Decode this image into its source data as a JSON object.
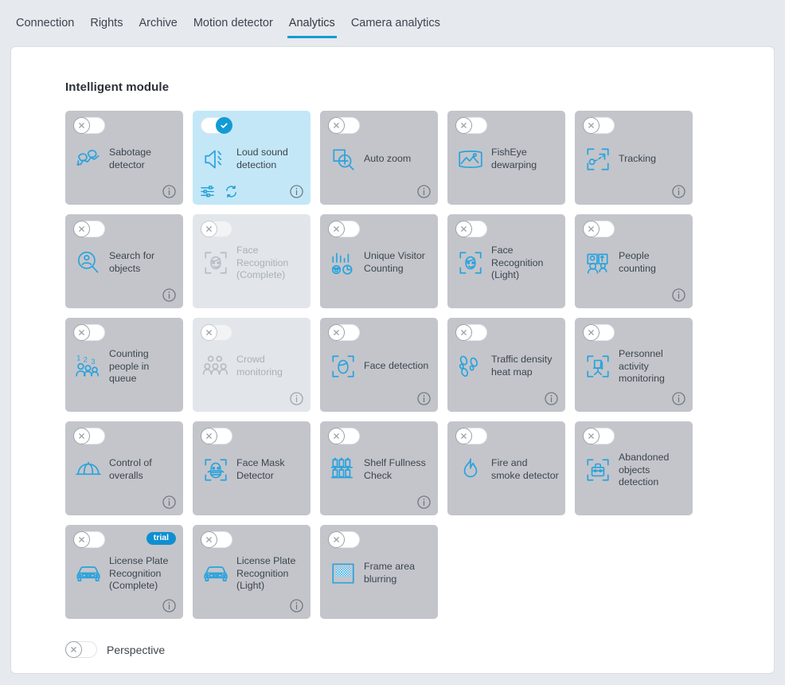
{
  "tabs": [
    {
      "label": "Connection",
      "active": false
    },
    {
      "label": "Rights",
      "active": false
    },
    {
      "label": "Archive",
      "active": false
    },
    {
      "label": "Motion detector",
      "active": false
    },
    {
      "label": "Analytics",
      "active": true
    },
    {
      "label": "Camera analytics",
      "active": false
    }
  ],
  "section": {
    "title": "Intelligent module"
  },
  "colors": {
    "accent": "#0e9ed4",
    "icon_blue": "#2aa3dd",
    "card_bg": "#c3c5cb",
    "card_bg_active": "#c3e7f7",
    "card_bg_disabled": "#e2e6ea",
    "badge_bg": "#0f8fd0",
    "page_bg": "#e6e9ed",
    "panel_bg": "#ffffff"
  },
  "modules": [
    {
      "label": "Sabotage detector",
      "icon": "sabotage-detector-icon",
      "enabled": false,
      "disabled": false,
      "info": true,
      "settings": false,
      "sync": false,
      "badge": null
    },
    {
      "label": "Loud sound detection",
      "icon": "loud-sound-detection-icon",
      "enabled": true,
      "disabled": false,
      "info": true,
      "settings": true,
      "sync": true,
      "badge": null
    },
    {
      "label": "Auto zoom",
      "icon": "auto-zoom-icon",
      "enabled": false,
      "disabled": false,
      "info": true,
      "settings": false,
      "sync": false,
      "badge": null
    },
    {
      "label": "FishEye dewarping",
      "icon": "fisheye-dewarping-icon",
      "enabled": false,
      "disabled": false,
      "info": false,
      "settings": false,
      "sync": false,
      "badge": null
    },
    {
      "label": "Tracking",
      "icon": "tracking-icon",
      "enabled": false,
      "disabled": false,
      "info": true,
      "settings": false,
      "sync": false,
      "badge": null
    },
    {
      "label": "Search for objects",
      "icon": "search-for-objects-icon",
      "enabled": false,
      "disabled": false,
      "info": true,
      "settings": false,
      "sync": false,
      "badge": null
    },
    {
      "label": "Face Recognition (Complete)",
      "icon": "face-recognition-icon",
      "enabled": false,
      "disabled": true,
      "info": false,
      "settings": false,
      "sync": false,
      "badge": null
    },
    {
      "label": "Unique Visitor Counting",
      "icon": "unique-visitor-counting-icon",
      "enabled": false,
      "disabled": false,
      "info": false,
      "settings": false,
      "sync": false,
      "badge": null
    },
    {
      "label": "Face Recognition (Light)",
      "icon": "face-recognition-icon",
      "enabled": false,
      "disabled": false,
      "info": false,
      "settings": false,
      "sync": false,
      "badge": null
    },
    {
      "label": "People counting",
      "icon": "people-counting-icon",
      "enabled": false,
      "disabled": false,
      "info": true,
      "settings": false,
      "sync": false,
      "badge": null
    },
    {
      "label": "Counting people in queue",
      "icon": "counting-people-queue-icon",
      "enabled": false,
      "disabled": false,
      "info": false,
      "settings": false,
      "sync": false,
      "badge": null
    },
    {
      "label": "Crowd monitoring",
      "icon": "crowd-monitoring-icon",
      "enabled": false,
      "disabled": true,
      "info": true,
      "settings": false,
      "sync": false,
      "badge": null
    },
    {
      "label": "Face detection",
      "icon": "face-detection-icon",
      "enabled": false,
      "disabled": false,
      "info": true,
      "settings": false,
      "sync": false,
      "badge": null
    },
    {
      "label": "Traffic density heat map",
      "icon": "traffic-density-heatmap-icon",
      "enabled": false,
      "disabled": false,
      "info": true,
      "settings": false,
      "sync": false,
      "badge": null
    },
    {
      "label": "Personnel activity monitoring",
      "icon": "personnel-activity-icon",
      "enabled": false,
      "disabled": false,
      "info": true,
      "settings": false,
      "sync": false,
      "badge": null
    },
    {
      "label": "Control of overalls",
      "icon": "control-of-overalls-icon",
      "enabled": false,
      "disabled": false,
      "info": true,
      "settings": false,
      "sync": false,
      "badge": null
    },
    {
      "label": "Face Mask Detector",
      "icon": "face-mask-detector-icon",
      "enabled": false,
      "disabled": false,
      "info": false,
      "settings": false,
      "sync": false,
      "badge": null
    },
    {
      "label": "Shelf Fullness Check",
      "icon": "shelf-fullness-check-icon",
      "enabled": false,
      "disabled": false,
      "info": true,
      "settings": false,
      "sync": false,
      "badge": null
    },
    {
      "label": "Fire and smoke detector",
      "icon": "fire-smoke-detector-icon",
      "enabled": false,
      "disabled": false,
      "info": false,
      "settings": false,
      "sync": false,
      "badge": null
    },
    {
      "label": "Abandoned objects detection",
      "icon": "abandoned-objects-icon",
      "enabled": false,
      "disabled": false,
      "info": false,
      "settings": false,
      "sync": false,
      "badge": null
    },
    {
      "label": "License Plate Recognition (Complete)",
      "icon": "license-plate-icon",
      "enabled": false,
      "disabled": false,
      "info": true,
      "settings": false,
      "sync": false,
      "badge": "trial"
    },
    {
      "label": "License Plate Recognition (Light)",
      "icon": "license-plate-icon",
      "enabled": false,
      "disabled": false,
      "info": true,
      "settings": false,
      "sync": false,
      "badge": null
    },
    {
      "label": "Frame area blurring",
      "icon": "frame-area-blurring-icon",
      "enabled": false,
      "disabled": false,
      "info": false,
      "settings": false,
      "sync": false,
      "badge": null
    }
  ],
  "perspective": {
    "label": "Perspective",
    "enabled": false
  }
}
